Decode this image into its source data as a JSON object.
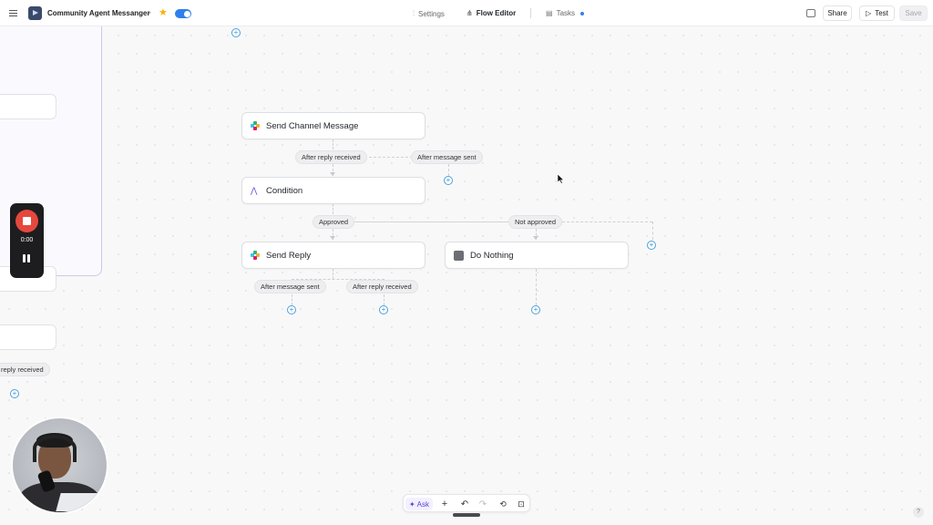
{
  "header": {
    "app_title": "Community Agent Messanger",
    "tabs": [
      {
        "label": "Settings",
        "icon": "settings-sliders-icon"
      },
      {
        "label": "Flow Editor",
        "icon": "flow-icon"
      },
      {
        "label": "Tasks",
        "icon": "tasks-icon"
      }
    ],
    "share_label": "Share",
    "test_label": "Test",
    "save_label": "Save",
    "toggle_on": true,
    "colors": {
      "accent": "#2f80ed",
      "star": "#f4b400"
    }
  },
  "left_panel": {
    "edge_label": "reply received"
  },
  "flow": {
    "nodes": [
      {
        "id": "send-channel-message",
        "label": "Send Channel Message",
        "icon": "slack-icon"
      },
      {
        "id": "condition",
        "label": "Condition",
        "icon": "condition-icon"
      },
      {
        "id": "send-reply",
        "label": "Send Reply",
        "icon": "slack-icon"
      },
      {
        "id": "do-nothing",
        "label": "Do Nothing",
        "icon": "app-icon"
      }
    ],
    "edges": {
      "after_reply_received_1": "After reply received",
      "after_message_sent_1": "After message sent",
      "approved": "Approved",
      "not_approved": "Not approved",
      "after_message_sent_2": "After message sent",
      "after_reply_received_2": "After reply received"
    }
  },
  "recorder": {
    "time": "0:00",
    "colors": {
      "stop": "#e5483d"
    }
  },
  "bottom_toolbar": {
    "ask_label": "Ask"
  },
  "help_label": "?"
}
